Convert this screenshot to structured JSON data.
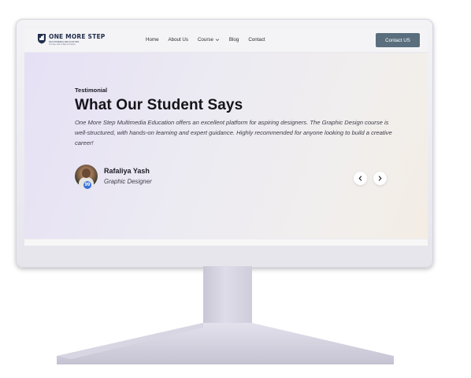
{
  "brand": {
    "name": "ONE MORE STEP",
    "subtitle": "MULTIMEDIA EDUCATION",
    "tagline": "You are Just a Step to Future"
  },
  "nav": {
    "items": [
      {
        "label": "Home"
      },
      {
        "label": "About Us"
      },
      {
        "label": "Course",
        "has_dropdown": true
      },
      {
        "label": "Blog"
      },
      {
        "label": "Contact"
      }
    ],
    "cta_label": "Contact US"
  },
  "hero": {
    "eyebrow": "Testimonial",
    "title": "What Our Student Says",
    "quote": "One More Step Multimedia Education offers an excellent platform for aspiring designers. The Graphic Design course is well-structured, with hands-on learning and expert guidance. Highly recommended for anyone looking to build a creative career!",
    "author_name": "Rafaliya Yash",
    "author_role": "Graphic Designer",
    "quote_badge": "99"
  },
  "icons": {
    "prev": "chevron-left-icon",
    "next": "chevron-right-icon",
    "dropdown": "chevron-down-icon",
    "logo": "shield-logo-icon"
  },
  "colors": {
    "cta_bg": "#5a6e7d",
    "badge_bg": "#3a6fd8",
    "logo_navy": "#22304d"
  }
}
